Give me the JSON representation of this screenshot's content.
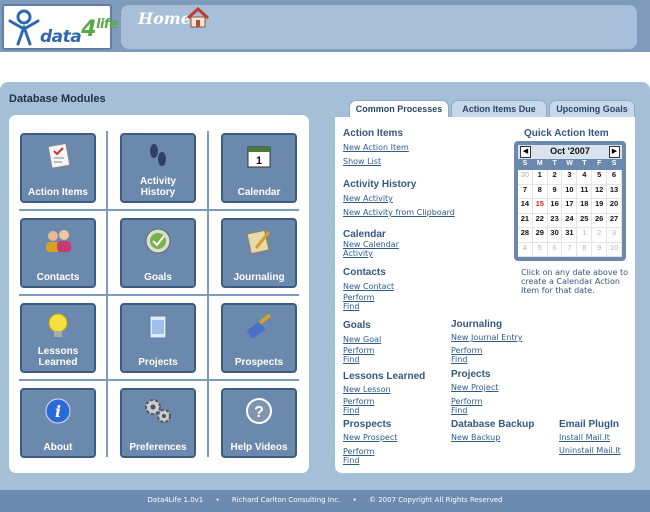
{
  "header": {
    "logo_text": "data4life",
    "title": "Home"
  },
  "modules": {
    "title": "Database Modules",
    "items": [
      {
        "label": "Action Items",
        "icon": "checklist-icon"
      },
      {
        "label": "Activity\nHistory",
        "icon": "footprints-icon"
      },
      {
        "label": "Calendar",
        "icon": "calendar-icon"
      },
      {
        "label": "Contacts",
        "icon": "people-icon"
      },
      {
        "label": "Goals",
        "icon": "goal-icon"
      },
      {
        "label": "Journaling",
        "icon": "notebook-pencil-icon"
      },
      {
        "label": "Lessons\nLearned",
        "icon": "lightbulb-icon"
      },
      {
        "label": "Projects",
        "icon": "folder-icon"
      },
      {
        "label": "Prospects",
        "icon": "paintbrush-icon"
      },
      {
        "label": "About",
        "icon": "info-icon"
      },
      {
        "label": "Preferences",
        "icon": "gears-icon"
      },
      {
        "label": "Help Videos",
        "icon": "question-icon"
      }
    ]
  },
  "tabs": [
    {
      "label": "Common Processes",
      "active": true
    },
    {
      "label": "Action Items Due",
      "active": false
    },
    {
      "label": "Upcoming Goals",
      "active": false
    }
  ],
  "processes": {
    "action_items": {
      "title": "Action Items",
      "links": [
        "New Action Item",
        "Show List"
      ]
    },
    "activity_history": {
      "title": "Activity History",
      "links": [
        "New Activity",
        "New Activity from Clipboard"
      ]
    },
    "calendar": {
      "title": "Calendar",
      "links": [
        "New Calendar",
        "Activity"
      ]
    },
    "contacts": {
      "title": "Contacts",
      "links": [
        "New Contact",
        "Perform",
        "Find"
      ]
    },
    "goals": {
      "title": "Goals",
      "links": [
        "New Goal",
        "Perform",
        "Find"
      ]
    },
    "journaling": {
      "title": "Journaling",
      "links": [
        "New Journal Entry",
        "Perform",
        "Find"
      ]
    },
    "lessons_learned": {
      "title": "Lessons Learned",
      "links": [
        "New Lesson",
        "Perform",
        "Find"
      ]
    },
    "projects": {
      "title": "Projects",
      "links": [
        "New Project",
        "Perform",
        "Find"
      ]
    },
    "prospects": {
      "title": "Prospects",
      "links": [
        "New Prospect",
        "Perform",
        "Find"
      ]
    },
    "database_backup": {
      "title": "Database Backup",
      "links": [
        "New Backup"
      ]
    },
    "email_plugin": {
      "title": "Email PlugIn",
      "links": [
        "Install Mail.It",
        "Uninstall Mail.It"
      ]
    }
  },
  "quick_action": {
    "title": "Quick Action Item",
    "month": "Oct '2007",
    "prev": "◀",
    "next": "▶",
    "weekdays": [
      "S",
      "M",
      "T",
      "W",
      "T",
      "F",
      "S"
    ],
    "weeks": [
      [
        "30",
        "1",
        "2",
        "3",
        "4",
        "5",
        "6"
      ],
      [
        "7",
        "8",
        "9",
        "10",
        "11",
        "12",
        "13"
      ],
      [
        "14",
        "15",
        "16",
        "17",
        "18",
        "19",
        "20"
      ],
      [
        "21",
        "22",
        "23",
        "24",
        "25",
        "26",
        "27"
      ],
      [
        "28",
        "29",
        "30",
        "31",
        "1",
        "2",
        "3"
      ],
      [
        "4",
        "5",
        "6",
        "7",
        "8",
        "9",
        "10"
      ]
    ],
    "today": "15",
    "note": "Click on any date above to create a Calendar Action Item for that date."
  },
  "footer": {
    "version": "Data4Life 1.0v1",
    "company": "Richard Carlton Consulting Inc.",
    "copyright": "© 2007 Copyright All Rights Reserved",
    "separator": "•"
  },
  "colors": {
    "header": "#7f9bbb",
    "main_bg": "#a5bfd6",
    "module_tile": "#6a89ad",
    "link": "#2f5b8a",
    "today": "#d42020"
  }
}
